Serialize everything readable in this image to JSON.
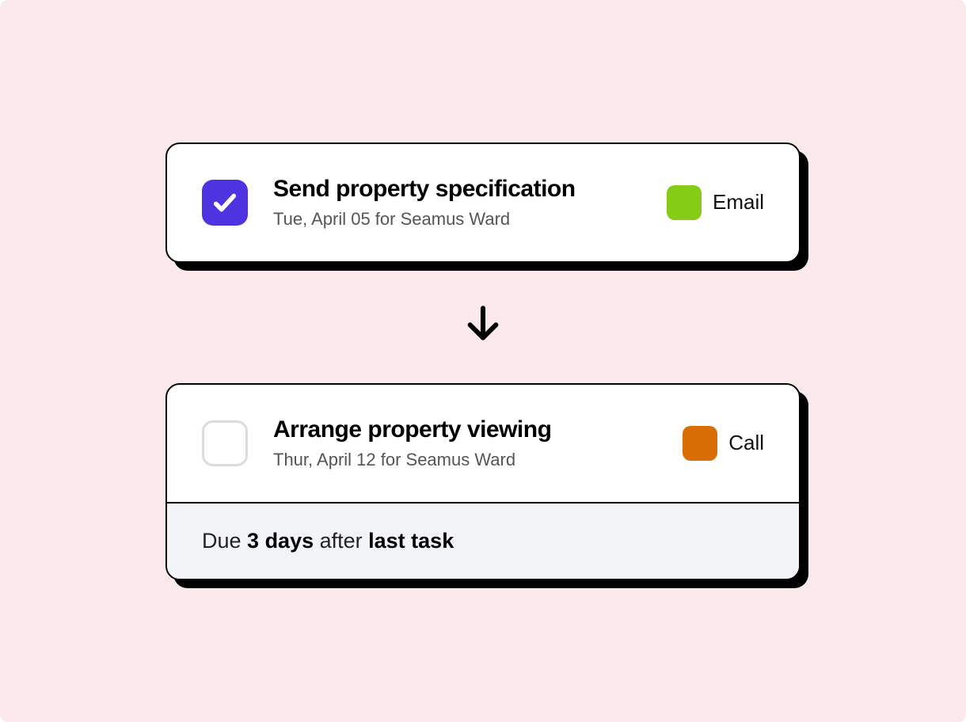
{
  "colors": {
    "checkboxChecked": "#4e34e0",
    "emailSwatch": "#85cc16",
    "callSwatch": "#d96e07"
  },
  "task1": {
    "title": "Send property specification",
    "subtitle": "Tue, April 05 for Seamus Ward",
    "tagLabel": "Email"
  },
  "task2": {
    "title": "Arrange property viewing",
    "subtitle": "Thur, April 12 for Seamus Ward",
    "tagLabel": "Call"
  },
  "dueRule": {
    "prefix": "Due ",
    "interval": "3 days",
    "middle": " after ",
    "anchor": "last task"
  }
}
